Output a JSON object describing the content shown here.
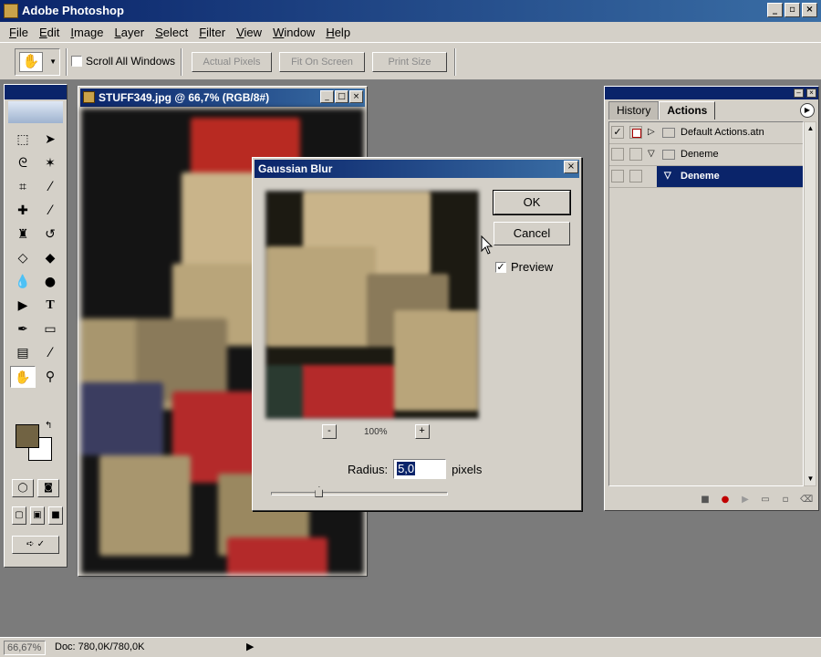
{
  "app": {
    "title": "Adobe Photoshop",
    "window_controls": [
      "_",
      "▫",
      "×"
    ]
  },
  "menubar": {
    "items": [
      "File",
      "Edit",
      "Image",
      "Layer",
      "Select",
      "Filter",
      "View",
      "Window",
      "Help"
    ]
  },
  "options_bar": {
    "tool_icon": "hand-icon",
    "scroll_all_windows_label": "Scroll All Windows",
    "scroll_all_windows_checked": false,
    "actual_pixels_label": "Actual Pixels",
    "fit_on_screen_label": "Fit On Screen",
    "print_size_label": "Print Size"
  },
  "toolbox": {
    "tools": [
      "marquee-icon",
      "move-icon",
      "lasso-icon",
      "magic-wand-icon",
      "crop-icon",
      "slice-icon",
      "healing-brush-icon",
      "brush-icon",
      "clone-stamp-icon",
      "history-brush-icon",
      "eraser-icon",
      "paint-bucket-icon",
      "blur-icon",
      "dodge-icon",
      "path-select-icon",
      "type-icon",
      "pen-icon",
      "rectangle-icon",
      "notes-icon",
      "eyedropper-icon",
      "hand-icon",
      "zoom-icon"
    ],
    "foreground_color": "#716343",
    "background_color": "#ffffff"
  },
  "document": {
    "title": "STUFF349.jpg @ 66,7% (RGB/8#)"
  },
  "gaussian_blur": {
    "title": "Gaussian Blur",
    "ok_label": "OK",
    "cancel_label": "Cancel",
    "preview_label": "Preview",
    "preview_checked": true,
    "zoom_minus": "-",
    "zoom_value": "100%",
    "zoom_plus": "+",
    "radius_label": "Radius:",
    "radius_value": "5,0",
    "radius_unit": "pixels",
    "radius_slider_fraction": 0.27
  },
  "actions_palette": {
    "tabs": [
      "History",
      "Actions"
    ],
    "active_tab": "Actions",
    "rows": [
      {
        "name": "Default Actions.atn",
        "checked": true,
        "dialog_toggle": true,
        "expanded": false,
        "level": 0,
        "selected": false
      },
      {
        "name": "Deneme",
        "checked": false,
        "dialog_toggle": false,
        "expanded": true,
        "level": 0,
        "selected": false
      },
      {
        "name": "Deneme",
        "checked": false,
        "dialog_toggle": false,
        "expanded": true,
        "level": 1,
        "selected": true
      }
    ]
  },
  "status_bar": {
    "zoom": "66,67%",
    "doc_info": "Doc: 780,0K/780,0K"
  }
}
